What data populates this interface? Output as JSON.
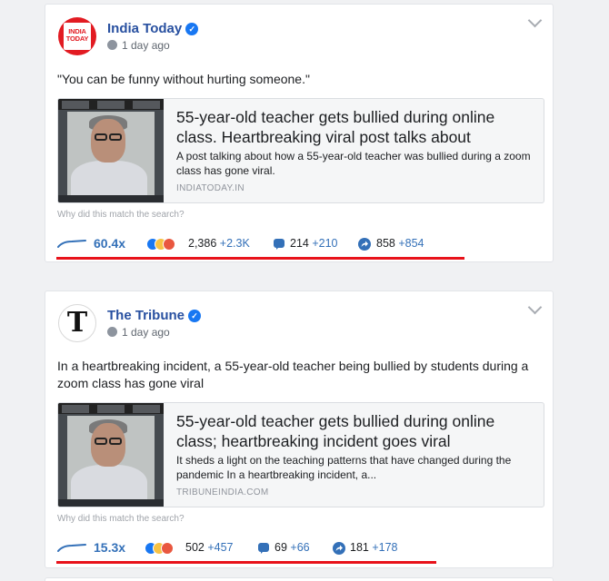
{
  "posts": [
    {
      "page_name": "India Today",
      "avatar_text": [
        "INDIA",
        "TODAY"
      ],
      "time": "1 day ago",
      "message": "\"You can be funny without hurting someone.\"",
      "link": {
        "title": "55-year-old teacher gets bullied during online class. Heartbreaking viral post talks about",
        "description": "A post talking about how a 55-year-old teacher was bullied during a zoom class has gone viral.",
        "domain": "INDIATODAY.IN"
      },
      "why_text": "Why did this match the search?",
      "overperform": "60.4x",
      "reactions": "2,386",
      "reactions_delta": "+2.3K",
      "comments": "214",
      "comments_delta": "+210",
      "shares": "858",
      "shares_delta": "+854"
    },
    {
      "page_name": "The Tribune",
      "avatar_text": "T",
      "time": "1 day ago",
      "message": "In a heartbreaking incident, a 55-year-old teacher being bullied by students during a zoom class has gone viral",
      "link": {
        "title": "55-year-old teacher gets bullied during online class; heartbreaking incident goes viral",
        "description": "It sheds a light on the teaching patterns that have changed during the pandemic In a heartbreaking incident, a...",
        "domain": "TRIBUNEINDIA.COM"
      },
      "why_text": "Why did this match the search?",
      "overperform": "15.3x",
      "reactions": "502",
      "reactions_delta": "+457",
      "comments": "69",
      "comments_delta": "+66",
      "shares": "181",
      "shares_delta": "+178"
    }
  ],
  "colors": {
    "accent": "#3370b8",
    "page_name": "#2850a0",
    "verified": "#1877f2",
    "highlight_line": "#e8121a",
    "like": "#1877f2",
    "haha": "#f7c244",
    "angry": "#e9573f"
  },
  "icons": {
    "trend": "sparkline-icon",
    "reactions": "reactions-icon",
    "comment": "comment-icon",
    "share": "share-icon",
    "globe": "globe-icon",
    "verified": "verified-check-icon",
    "menu": "chevron-down-icon"
  }
}
